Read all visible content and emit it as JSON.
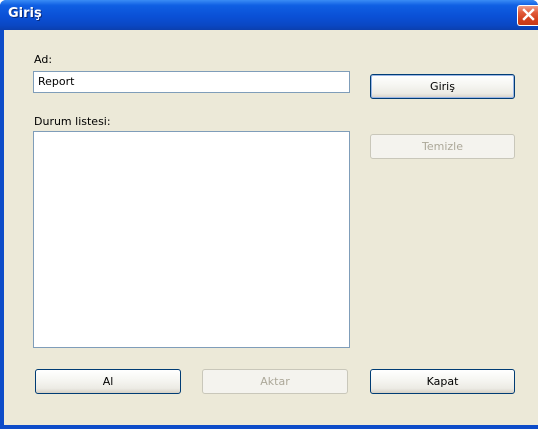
{
  "window": {
    "title": "Giriş"
  },
  "form": {
    "name_label": "Ad:",
    "name_value": "Report",
    "status_list_label": "Durum listesi:",
    "status_items": []
  },
  "buttons": {
    "login": "Giriş",
    "clear": "Temizle",
    "get": "Al",
    "transfer": "Aktar",
    "close": "Kapat"
  },
  "icons": {
    "close": "close-icon"
  },
  "colors": {
    "titlebar": "#0a50d6",
    "client_bg": "#ece9d8",
    "close_button": "#d2401d",
    "disabled_text": "#aca899",
    "field_border": "#7f9db9"
  }
}
